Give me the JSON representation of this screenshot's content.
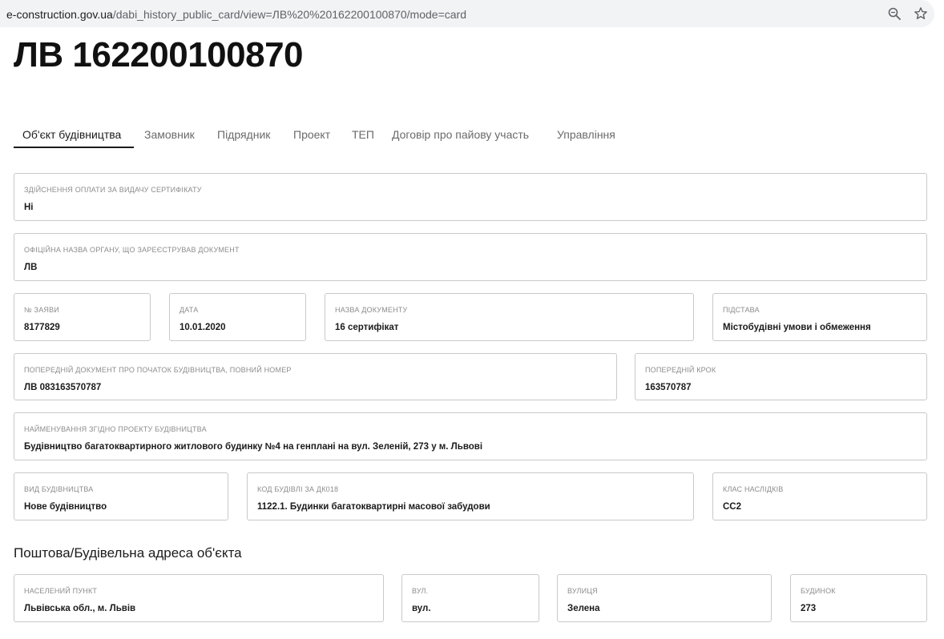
{
  "browser": {
    "url_domain": "e-construction.gov.ua",
    "url_path": "/dabi_history_public_card/view=ЛВ%20%20162200100870/mode=card",
    "zoom_icon": "magnifier-icon",
    "bookmark_icon": "star-icon"
  },
  "page": {
    "title": "ЛВ 162200100870"
  },
  "tabs": [
    {
      "label": "Об'єкт будівництва",
      "active": true
    },
    {
      "label": "Замовник"
    },
    {
      "label": "Підрядник"
    },
    {
      "label": "Проект"
    },
    {
      "label": "ТЕП"
    },
    {
      "label": "Договір про пайову участь"
    },
    {
      "label": "Управління"
    }
  ],
  "fields": {
    "payment": {
      "label": "Здійснення оплати за видачу сертифікату",
      "value": "Ні"
    },
    "authority": {
      "label": "Офіційна назва органу, що зареєстрував документ",
      "value": "ЛВ"
    },
    "application_no": {
      "label": "№ заяви",
      "value": "8177829"
    },
    "date": {
      "label": "Дата",
      "value": "10.01.2020"
    },
    "doc_name": {
      "label": "Назва документу",
      "value": "16 сертифікат"
    },
    "basis": {
      "label": "Підстава",
      "value": "Містобудівні умови і обмеження"
    },
    "prev_doc": {
      "label": "Попередній документ про початок будівництва, повний номер",
      "value": "ЛВ 083163570787"
    },
    "prev_step": {
      "label": "Попередній крок",
      "value": "163570787"
    },
    "project_name": {
      "label": "Найменування згідно проекту будівництва",
      "value": "Будівництво багатоквартирного житлового будинку №4 на генплані на вул. Зеленій, 273 у м. Львові"
    },
    "construction_type": {
      "label": "Вид будівництва",
      "value": "Нове будівництво"
    },
    "building_code": {
      "label": "Код будівлі за ДК018",
      "value": "1122.1. Будинки багатоквартирні масової забудови"
    },
    "consequence_class": {
      "label": "Клас наслідків",
      "value": "СС2"
    }
  },
  "address": {
    "section_title": "Поштова/Будівельна адреса об'єкта",
    "settlement": {
      "label": "Населений пункт",
      "value": "Львівська обл., м. Львів"
    },
    "street_type": {
      "label": "вул.",
      "value": "вул."
    },
    "street": {
      "label": "Вулиця",
      "value": "Зелена"
    },
    "building": {
      "label": "Будинок",
      "value": "273"
    }
  }
}
